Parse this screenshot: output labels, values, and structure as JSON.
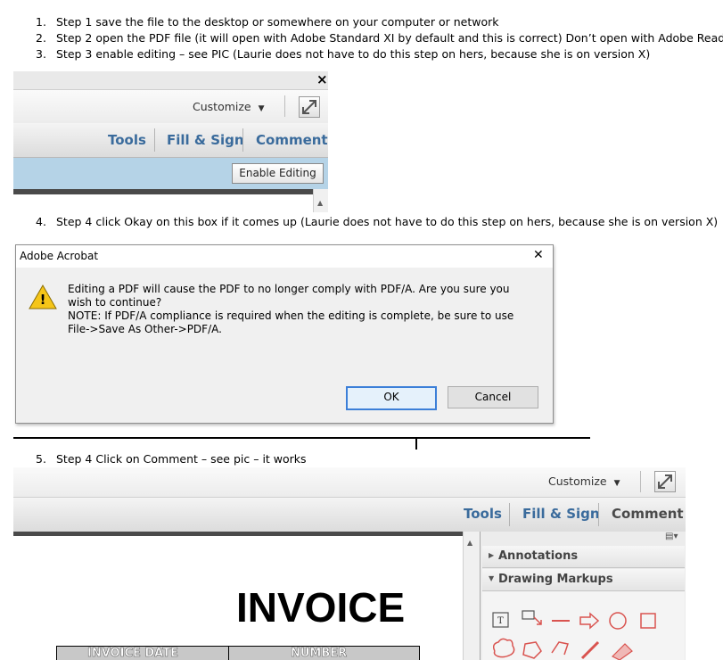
{
  "steps": [
    {
      "num": "1.",
      "text": "Step 1 save the file to the desktop or somewhere on your computer or network"
    },
    {
      "num": "2.",
      "text": "Step 2 open the PDF file (it will open with Adobe Standard XI by default and this is correct) Don’t open with Adobe Reader"
    },
    {
      "num": "3.",
      "text": "Step 3 enable editing – see PIC (Laurie does not have to do this step on hers, because she is on version X)"
    },
    {
      "num": "4.",
      "text": "Step 4 click Okay on this box if it comes up (Laurie does not have to do this step on hers, because she is on version X)"
    },
    {
      "num": "5.",
      "text": "Step 4 Click on Comment – see pic – it works"
    }
  ],
  "shot1": {
    "close_glyph": "×",
    "customize_label": "Customize",
    "customize_caret": "▼",
    "tabs": {
      "tools": "Tools",
      "fill_sign": "Fill & Sign",
      "comment": "Comment"
    },
    "enable_editing_label": "Enable Editing",
    "scroll_up_glyph": "▲"
  },
  "dialog": {
    "title": "Adobe Acrobat",
    "close_glyph": "✕",
    "warning_glyph": "!",
    "message_line1": "Editing a PDF will cause the PDF to no longer comply with PDF/A.  Are you sure you wish to continue?",
    "message_line2": "NOTE: If PDF/A compliance is required when the editing is complete, be sure to use File->Save As Other->PDF/A.",
    "ok_label": "OK",
    "cancel_label": "Cancel"
  },
  "shot2": {
    "customize_label": "Customize",
    "customize_caret": "▼",
    "tabs": {
      "tools": "Tools",
      "fill_sign": "Fill & Sign",
      "comment": "Comment"
    },
    "scroll_up_glyph": "▲",
    "panel_options_glyph": "▤▾",
    "annotations_label": "Annotations",
    "annotations_tri": "▶",
    "drawing_markups_label": "Drawing Markups",
    "drawing_markups_tri": "▼",
    "invoice_title": "INVOICE",
    "table_headers": [
      "INVOICE DATE",
      "NUMBER"
    ]
  },
  "colors": {
    "tab_blue": "#3a6b9c",
    "enable_bar": "#b5d3e7",
    "markup_red": "#d9534f",
    "dialog_accent": "#3c7fd8"
  },
  "icons": [
    "text-box-icon",
    "text-callout-icon",
    "line-icon",
    "arrow-icon",
    "oval-icon",
    "rectangle-icon",
    "cloud-icon",
    "polygon-icon",
    "connected-lines-icon",
    "pencil-icon",
    "eraser-icon"
  ]
}
